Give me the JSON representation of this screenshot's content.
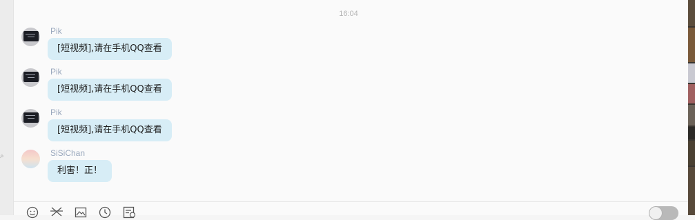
{
  "chat": {
    "timestamp": "16:04",
    "messages": [
      {
        "sender": "Pik",
        "text": "[短视频],请在手机QQ查看"
      },
      {
        "sender": "Pik",
        "text": "[短视频],请在手机QQ查看"
      },
      {
        "sender": "Pik",
        "text": "[短视频],请在手机QQ查看"
      },
      {
        "sender": "SiSiChan",
        "text": "利害！正！"
      }
    ]
  },
  "toolbar": {
    "icons": [
      "emoji-icon",
      "scissors-icon",
      "image-icon",
      "clock-icon",
      "file-icon"
    ]
  },
  "colors": {
    "bubble": "#d7edf6",
    "sender": "#9aa8bd",
    "timestamp": "#b3b3b3"
  }
}
